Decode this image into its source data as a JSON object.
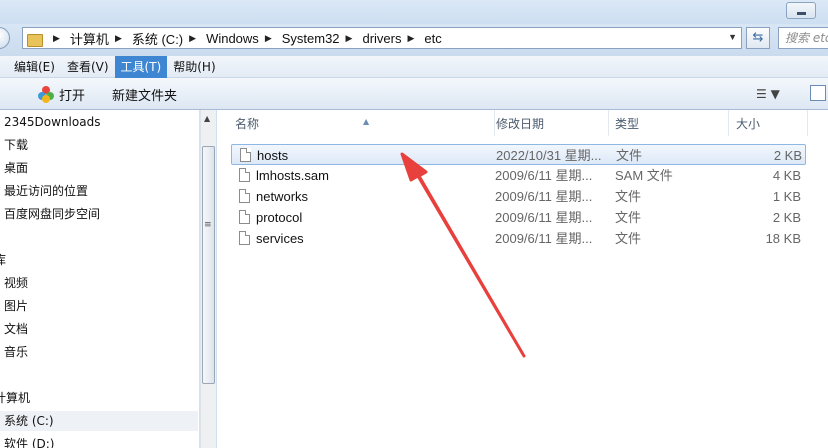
{
  "address": {
    "breadcrumbs": [
      "计算机",
      "系统 (C:)",
      "Windows",
      "System32",
      "drivers",
      "etc"
    ],
    "search_placeholder": "搜索 etc"
  },
  "menu": [
    "编辑(E)",
    "查看(V)",
    "工具(T)",
    "帮助(H)"
  ],
  "toolbar": {
    "open_label": "打开",
    "new_folder_label": "新建文件夹"
  },
  "sidebar": {
    "items": [
      {
        "label": "2345Downloads",
        "indent": 1
      },
      {
        "label": "下载",
        "indent": 1
      },
      {
        "label": "桌面",
        "indent": 1
      },
      {
        "label": "最近访问的位置",
        "indent": 1
      },
      {
        "label": "百度网盘同步空间",
        "indent": 1
      },
      {
        "label": "库",
        "indent": 0
      },
      {
        "label": "视频",
        "indent": 1
      },
      {
        "label": "图片",
        "indent": 1
      },
      {
        "label": "文档",
        "indent": 1
      },
      {
        "label": "音乐",
        "indent": 1
      },
      {
        "label": "计算机",
        "indent": 0
      },
      {
        "label": "系统 (C:)",
        "indent": 1,
        "selected": true
      },
      {
        "label": "软件 (D:)",
        "indent": 1
      }
    ]
  },
  "columns": {
    "name": "名称",
    "date": "修改日期",
    "type": "类型",
    "size": "大小"
  },
  "files": [
    {
      "name": "hosts",
      "date": "2022/10/31 星期...",
      "type": "文件",
      "size": "2 KB",
      "selected": true
    },
    {
      "name": "lmhosts.sam",
      "date": "2009/6/11 星期...",
      "type": "SAM 文件",
      "size": "4 KB"
    },
    {
      "name": "networks",
      "date": "2009/6/11 星期...",
      "type": "文件",
      "size": "1 KB"
    },
    {
      "name": "protocol",
      "date": "2009/6/11 星期...",
      "type": "文件",
      "size": "2 KB"
    },
    {
      "name": "services",
      "date": "2009/6/11 星期...",
      "type": "文件",
      "size": "18 KB"
    }
  ],
  "colors": {
    "accent": "#3f86d2",
    "annotation_arrow": "#e8403c",
    "selection_border": "#8fb7e4"
  }
}
